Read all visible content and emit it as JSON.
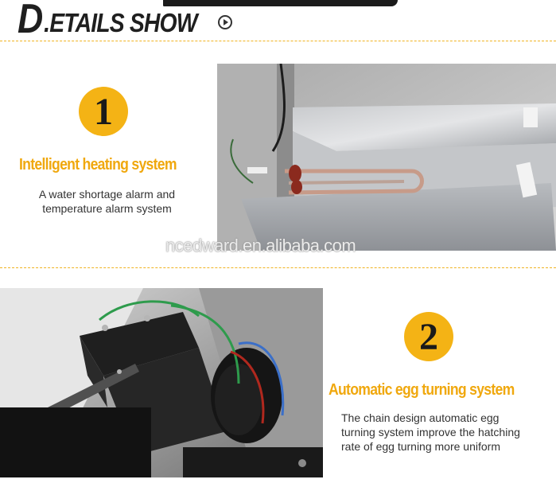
{
  "header": {
    "title_initial": "D",
    "title_rest": ".ETAILS SHOW",
    "arrow_icon": "circle-arrow-right-icon"
  },
  "features": [
    {
      "number": "1",
      "title": "Intelligent heating system",
      "description_lines": [
        "A water shortage alarm and",
        "temperature alarm system"
      ]
    },
    {
      "number": "2",
      "title": "Automatic egg turning system",
      "description_lines": [
        "The chain design automatic egg",
        "turning system improve the hatching",
        "rate of egg turning more uniform"
      ]
    }
  ],
  "watermark": "ncedward.en.alibaba.com",
  "colors": {
    "accent": "#f4b315",
    "title_orange": "#f0a80e",
    "divider": "#f0b422"
  }
}
